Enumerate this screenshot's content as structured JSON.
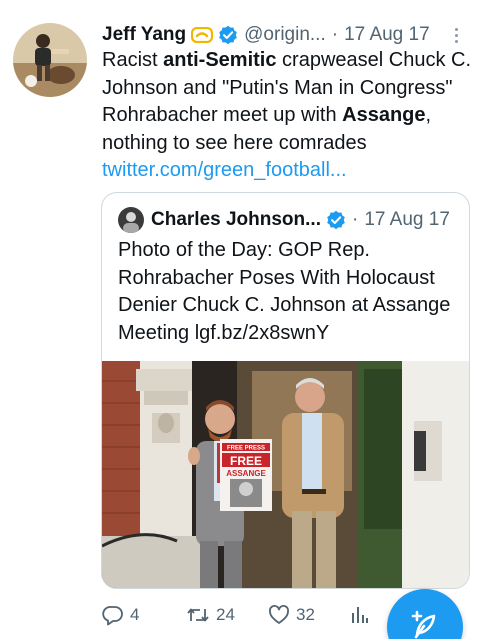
{
  "tweet": {
    "author_name": "Jeff Yang",
    "author_handle": "@origin...",
    "separator": "·",
    "date": "17 Aug 17",
    "text_parts": {
      "p1": "Racist ",
      "p2": "anti-Semitic",
      "p3": " crapweasel Chuck C. Johnson and \"Putin's Man in Congress\" Rohrabacher meet up with ",
      "p4": "Assange",
      "p5": ", nothing to see here comrades ",
      "link": "twitter.com/green_football..."
    }
  },
  "quote": {
    "author_name": "Charles Johnson...",
    "separator": "·",
    "date": "17 Aug 17",
    "text": "Photo of the Day: GOP Rep. Rohrabacher Poses With Holocaust Denier Chuck C. Johnson at Assange Meeting lgf.bz/2x8swnY",
    "photo": {
      "poster_line1": "FREE PRESS",
      "poster_line2": "FREE",
      "poster_line3": "ASSANGE"
    }
  },
  "actions": {
    "reply_count": "4",
    "retweet_count": "24",
    "like_count": "32"
  },
  "icons": {
    "verified": "verified-badge-icon",
    "gold_badge": "gold-badge-icon",
    "more": "more-options-icon",
    "reply": "reply-icon",
    "retweet": "retweet-icon",
    "like": "heart-icon",
    "views": "views-chart-icon",
    "compose": "compose-feather-icon"
  },
  "colors": {
    "accent": "#1d9bf0",
    "gold": "#f4b400",
    "text": "#0f1419",
    "secondary": "#536471",
    "border": "#cfd9de"
  }
}
